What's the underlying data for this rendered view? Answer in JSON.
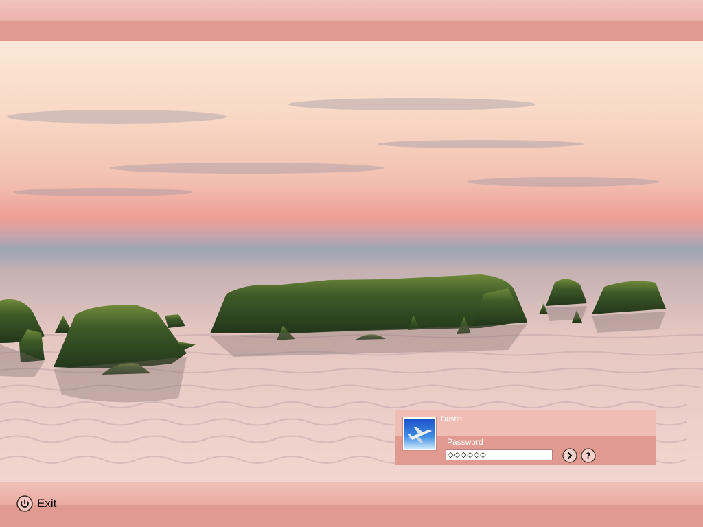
{
  "login": {
    "user_name": "Dustin",
    "password_label": "Password",
    "password_masked": "◇◇◇◇◇◇",
    "avatar_icon": "airplane-icon",
    "go_icon": "arrow-right-icon",
    "help_icon": "question-mark-icon"
  },
  "footer": {
    "exit_label": "Exit",
    "exit_icon": "power-icon"
  },
  "colors": {
    "bar_light": "#f1c4bc",
    "bar_dark": "#e09a8f",
    "panel_top": "#f0bdb4",
    "panel_bottom": "#e09a8f"
  }
}
